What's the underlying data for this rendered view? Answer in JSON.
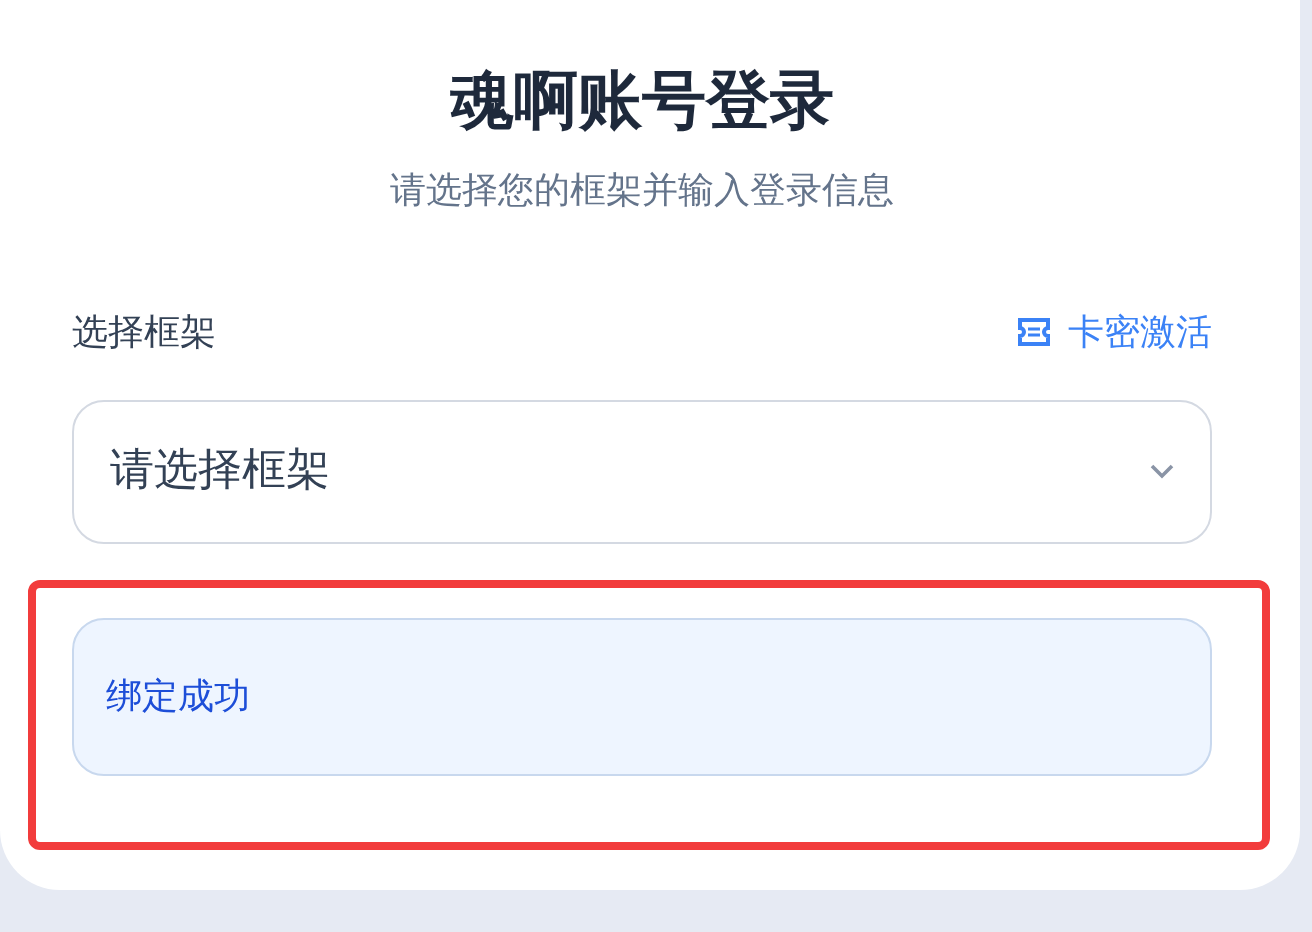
{
  "title": "魂啊账号登录",
  "subtitle": "请选择您的框架并输入登录信息",
  "framework": {
    "label": "选择框架",
    "link": "卡密激活",
    "placeholder": "请选择框架"
  },
  "alert": {
    "text": "绑定成功",
    "kind": "info"
  }
}
